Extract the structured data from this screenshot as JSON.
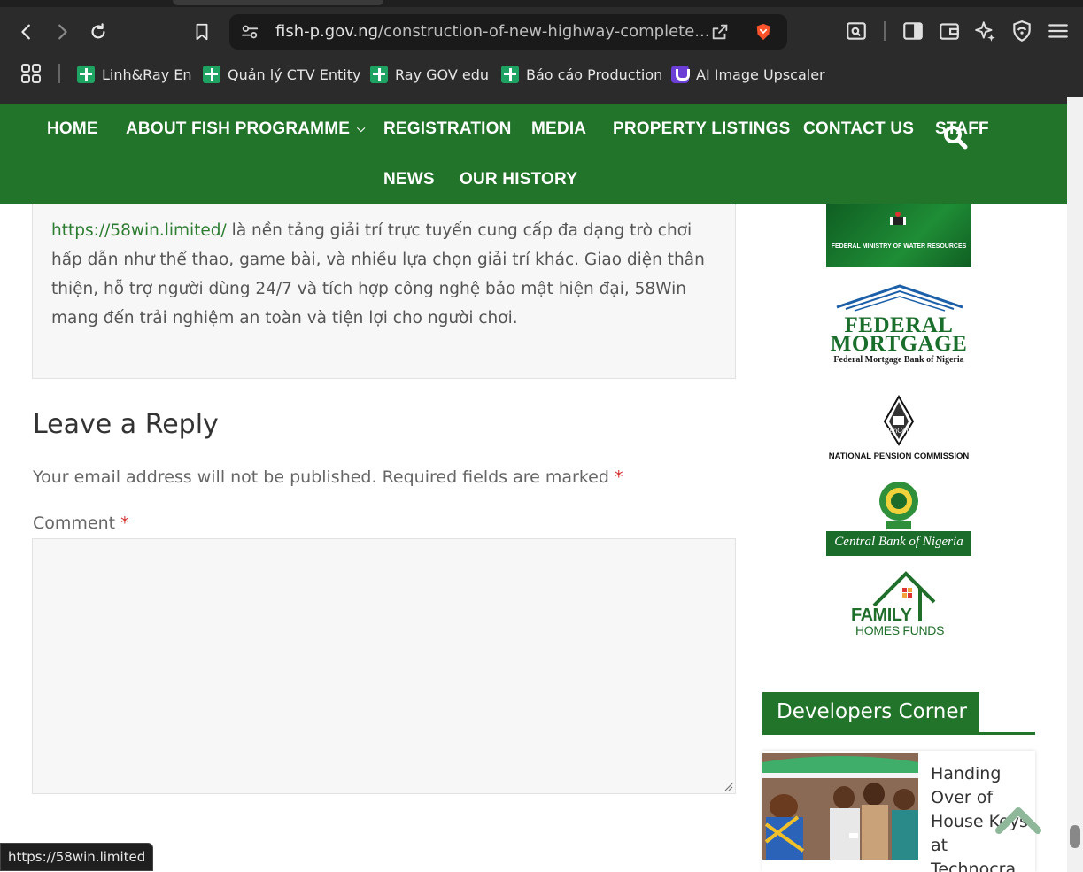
{
  "browser": {
    "url_domain": "fish-p.gov.ng",
    "url_path": "/construction-of-new-highway-complete...",
    "bookmarks": [
      {
        "label": "Linh&Ray En"
      },
      {
        "label": "Quản lý CTV Entity"
      },
      {
        "label": "Ray GOV edu"
      },
      {
        "label": "Báo cáo Production"
      },
      {
        "label": "AI Image Upscaler"
      }
    ],
    "status_url": "https://58win.limited"
  },
  "nav": {
    "items": [
      "HOME",
      "ABOUT FISH PROGRAMME",
      "REGISTRATION",
      "MEDIA",
      "PROPERTY LISTINGS",
      "CONTACT US",
      "STAFF",
      "NEWS",
      "OUR HISTORY"
    ]
  },
  "comment": {
    "link": "https://58win.limited/",
    "line1_rest": " là nền tảng giải trí trực tuyến cung cấp đa dạng trò chơi",
    "line2": "hấp dẫn như thể thao, game bài, và nhiều lựa chọn giải trí khác. Giao diện thân",
    "line3": "thiện, hỗ trợ người dùng 24/7 và tích hợp công nghệ bảo mật hiện đại, 58Win",
    "line4": "mang đến trải nghiệm an toàn và tiện lợi cho người chơi."
  },
  "reply": {
    "title": "Leave a Reply",
    "note": "Your email address will not be published. Required fields are marked",
    "required_mark": "*",
    "comment_label": "Comment"
  },
  "sidebar": {
    "water_logo_text": "FEDERAL MINISTRY OF WATER RESOURCES",
    "fm_line1": "FEDERAL",
    "fm_line2": "MORTGAGE",
    "fm_sub": "Federal Mortgage Bank of Nigeria",
    "pencom_badge": "PenCom",
    "pencom_text": "NATIONAL PENSION COMMISSION",
    "cbn_text": "Central Bank of Nigeria",
    "fhf_line1": "FAMILY",
    "fhf_line2": "HOMES FUNDS",
    "dev_heading": "Developers Corner",
    "dev_post_title": "Handing Over of House Keys at Technocra..."
  },
  "colors": {
    "brand_green": "#22742a",
    "link_green": "#2e7d32",
    "required_red": "#d32f2f"
  }
}
